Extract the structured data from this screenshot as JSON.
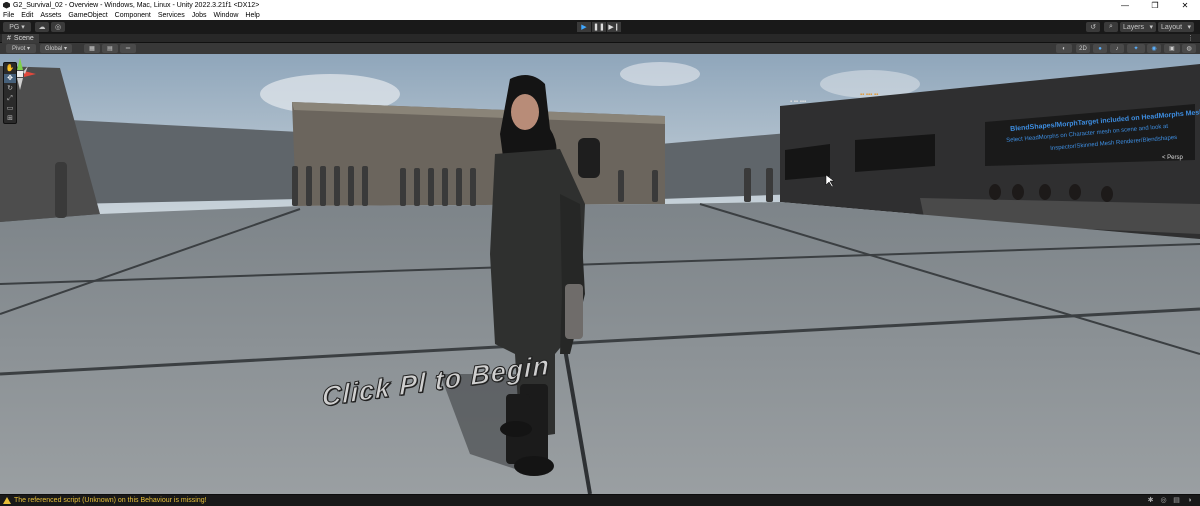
{
  "window": {
    "title": "G2_Survival_02 - Overview - Windows, Mac, Linux - Unity 2022.3.21f1 <DX12>",
    "controls": [
      "—",
      "❐",
      "✕"
    ]
  },
  "menu": [
    "File",
    "Edit",
    "Assets",
    "GameObject",
    "Component",
    "Services",
    "Jobs",
    "Window",
    "Help"
  ],
  "toolbar": {
    "account_label": "PG",
    "layers_label": "Layers",
    "layout_label": "Layout"
  },
  "tabs": {
    "scene_label": "Scene",
    "menu_glyph": "⋮"
  },
  "scene_toolbar": {
    "pivot_label": "Pivot",
    "global_label": "Global",
    "mode_2d_label": "2D"
  },
  "viewport": {
    "persp_label": "< Persp",
    "overlay_text": "Click Pl      to Begin",
    "wall_title": "BlendShapes/MorphTarget included on HeadMorphs Mesh",
    "wall_line1": "Select HeadMorphs on Character mesh on scene and look at",
    "wall_line2": "Inspector/Skinned Mesh Renderer/Blendshapes"
  },
  "status": {
    "message": "The referenced script (Unknown) on this Behaviour is missing!"
  },
  "colors": {
    "accent": "#3fa7ff",
    "warning": "#e8c03a",
    "editor_bg": "#191919"
  }
}
